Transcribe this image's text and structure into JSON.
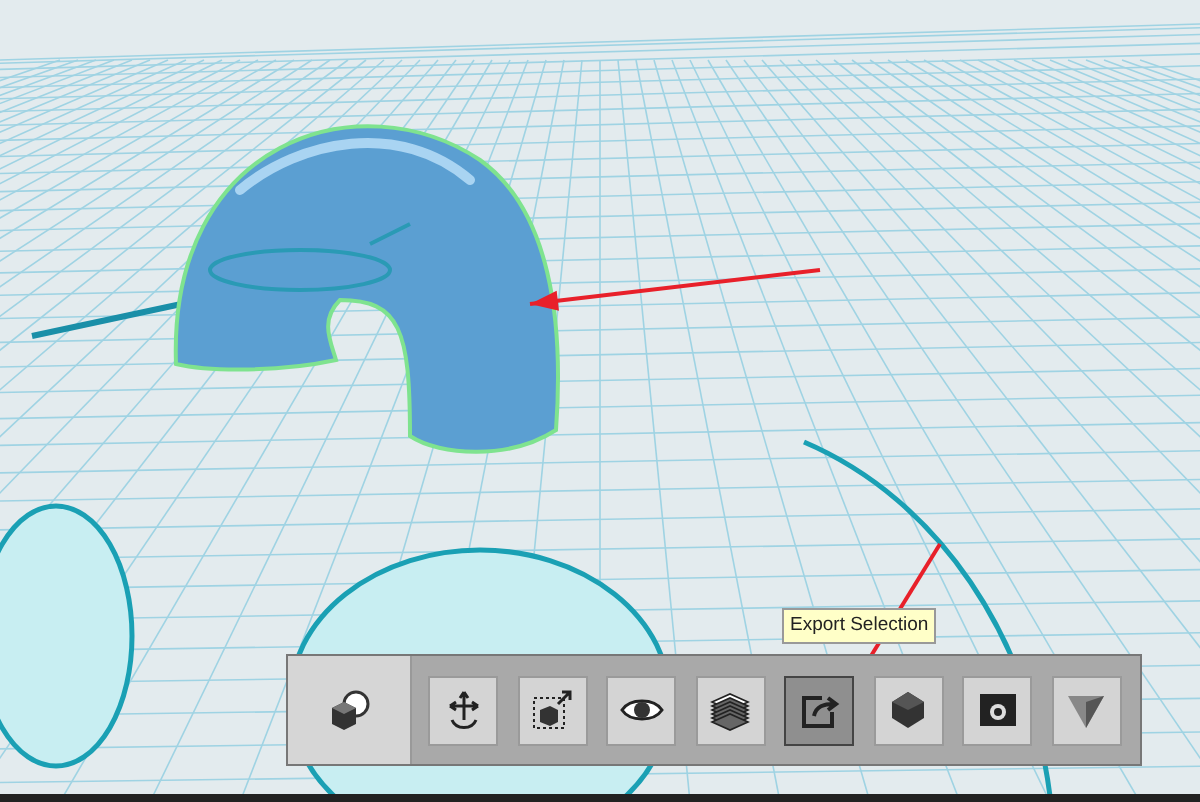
{
  "toolbar": {
    "primary_tool": {
      "kind": "primitives",
      "selected": false
    },
    "tools": [
      {
        "kind": "move",
        "selected": false
      },
      {
        "kind": "scale",
        "selected": false
      },
      {
        "kind": "view",
        "selected": false
      },
      {
        "kind": "layers",
        "selected": false
      },
      {
        "kind": "export",
        "selected": true
      },
      {
        "kind": "solid",
        "selected": false
      },
      {
        "kind": "snapshot",
        "selected": false
      },
      {
        "kind": "render",
        "selected": false
      }
    ],
    "tooltip": "Export Selection"
  }
}
